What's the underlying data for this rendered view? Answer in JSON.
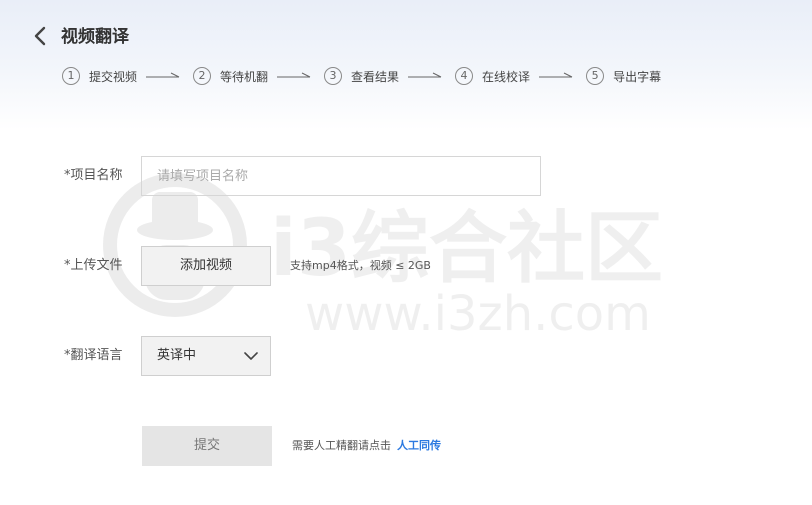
{
  "header": {
    "title": "视频翻译",
    "back_icon": "chevron-left-icon"
  },
  "steps": [
    {
      "num": "1",
      "label": "提交视频"
    },
    {
      "num": "2",
      "label": "等待机翻"
    },
    {
      "num": "3",
      "label": "查看结果"
    },
    {
      "num": "4",
      "label": "在线校译"
    },
    {
      "num": "5",
      "label": "导出字幕"
    }
  ],
  "watermark": {
    "text": "i3综合社区",
    "url": "www.i3zh.com"
  },
  "form": {
    "project_name": {
      "label": "*项目名称",
      "placeholder": "请填写项目名称",
      "value": ""
    },
    "upload": {
      "label": "*上传文件",
      "button_label": "添加视频",
      "hint": "支持mp4格式，视频 ≤ 2GB"
    },
    "language": {
      "label": "*翻译语言",
      "selected": "英译中",
      "icon": "chevron-down-icon"
    },
    "submit": {
      "button_label": "提交",
      "hint": "需要人工精翻请点击",
      "link_label": "人工同传"
    }
  },
  "colors": {
    "link": "#2b79e0",
    "header_gradient_top": "#e9eef8",
    "button_bg": "#f2f2f2",
    "submit_bg": "#e5e5e5"
  }
}
